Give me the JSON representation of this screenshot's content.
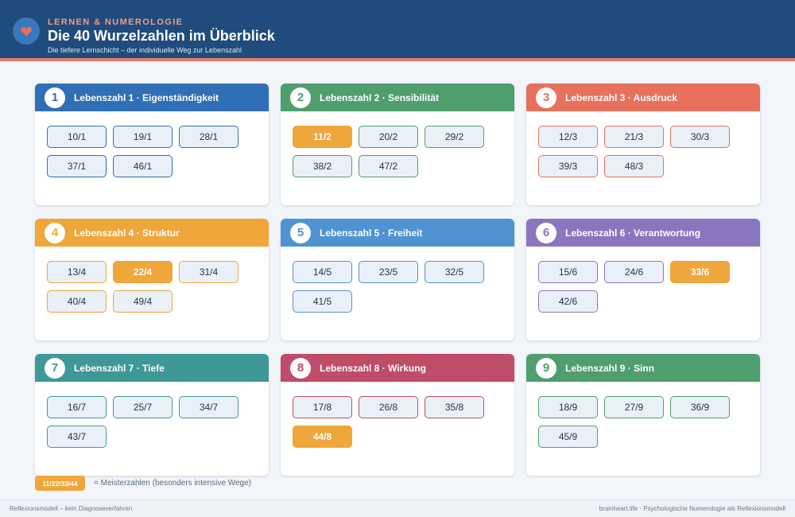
{
  "header": {
    "kicker": "LERNEN & NUMEROLOGIE",
    "title": "Die 40 Wurzelzahlen im Überblick",
    "subtitle": "Die tiefere Lernschicht – der individuelle Weg zur Lebenszahl",
    "logo_icon": "heart-icon"
  },
  "colors": {
    "header_bg": "#1f4c7c",
    "accent_stripe": "#e47b66",
    "master": "#efa63a"
  },
  "cards": [
    {
      "number": "1",
      "title": "Lebenszahl 1 · Eigenständigkeit",
      "color": "#2f6fb5",
      "roots": [
        "10/1",
        "19/1",
        "28/1",
        "37/1",
        "46/1"
      ],
      "masters": []
    },
    {
      "number": "2",
      "title": "Lebenszahl 2 · Sensibilität",
      "color": "#4f9e6e",
      "roots": [
        "11/2",
        "20/2",
        "29/2",
        "38/2",
        "47/2"
      ],
      "masters": [
        "11/2"
      ]
    },
    {
      "number": "3",
      "title": "Lebenszahl 3 · Ausdruck",
      "color": "#e8705c",
      "roots": [
        "12/3",
        "21/3",
        "30/3",
        "39/3",
        "48/3"
      ],
      "masters": []
    },
    {
      "number": "4",
      "title": "Lebenszahl 4 · Struktur",
      "color": "#efa63a",
      "roots": [
        "13/4",
        "22/4",
        "31/4",
        "40/4",
        "49/4"
      ],
      "masters": [
        "22/4"
      ]
    },
    {
      "number": "5",
      "title": "Lebenszahl 5 · Freiheit",
      "color": "#4f93d2",
      "roots": [
        "14/5",
        "23/5",
        "32/5",
        "41/5"
      ],
      "masters": []
    },
    {
      "number": "6",
      "title": "Lebenszahl 6 · Verantwortung",
      "color": "#8a76be",
      "roots": [
        "15/6",
        "24/6",
        "33/6",
        "42/6"
      ],
      "masters": [
        "33/6"
      ]
    },
    {
      "number": "7",
      "title": "Lebenszahl 7 · Tiefe",
      "color": "#3f9898",
      "roots": [
        "16/7",
        "25/7",
        "34/7",
        "43/7"
      ],
      "masters": []
    },
    {
      "number": "8",
      "title": "Lebenszahl 8 · Wirkung",
      "color": "#bf4c69",
      "roots": [
        "17/8",
        "26/8",
        "35/8",
        "44/8"
      ],
      "masters": [
        "44/8"
      ]
    },
    {
      "number": "9",
      "title": "Lebenszahl 9 · Sinn",
      "color": "#4f9e6e",
      "roots": [
        "18/9",
        "27/9",
        "36/9",
        "45/9"
      ],
      "masters": []
    }
  ],
  "legend": {
    "chip": "11/22/33/44",
    "text": "= Meisterzahlen (besonders intensive Wege)"
  },
  "footer": {
    "left": "Reflexionsmodell – kein Diagnoseverfahren",
    "right": "brainheart.life · Psychologische Numerologie als Reflexionsmodell"
  }
}
